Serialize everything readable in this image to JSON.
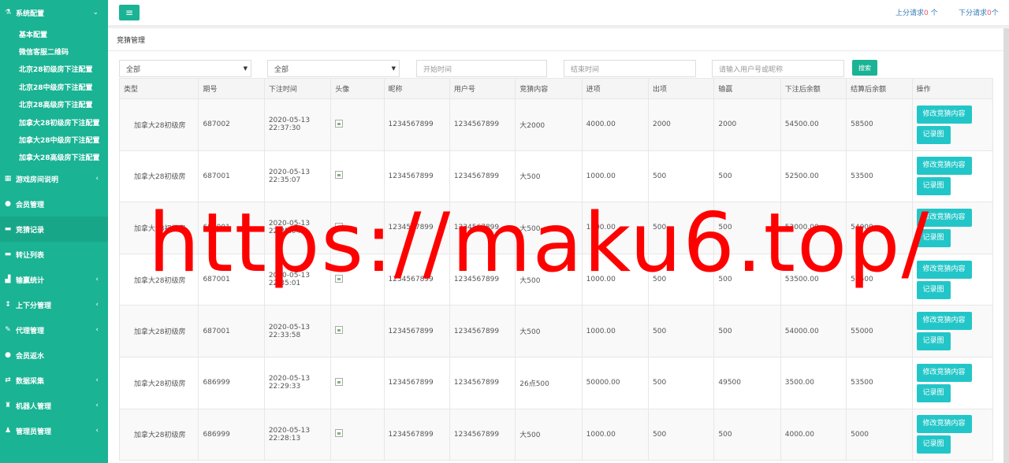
{
  "sidebar": {
    "sections": [
      {
        "label": "系统配置",
        "icon": "flask-icon",
        "expanded": true,
        "sub": [
          "基本配置",
          "微信客服二维码",
          "北京28初级房下注配置",
          "北京28中级房下注配置",
          "北京28高级房下注配置",
          "加拿大28初级房下注配置",
          "加拿大28中级房下注配置",
          "加拿大28高级房下注配置"
        ]
      },
      {
        "label": "游戏房间说明",
        "icon": "table-icon",
        "chevron": "‹"
      },
      {
        "label": "会员管理",
        "icon": "user-icon"
      },
      {
        "label": "竞猜记录",
        "icon": "car-icon",
        "active": true
      },
      {
        "label": "转让列表",
        "icon": "car-icon"
      },
      {
        "label": "输赢统计",
        "icon": "chart-icon",
        "chevron": "‹"
      },
      {
        "label": "上下分管理",
        "icon": "updown-icon",
        "chevron": "‹"
      },
      {
        "label": "代理管理",
        "icon": "pencil-icon",
        "chevron": "‹"
      },
      {
        "label": "会员返水",
        "icon": "users-icon"
      },
      {
        "label": "数据采集",
        "icon": "shuffle-icon",
        "chevron": "‹"
      },
      {
        "label": "机器人管理",
        "icon": "robot-icon",
        "chevron": "‹"
      },
      {
        "label": "管理员管理",
        "icon": "admin-icon",
        "chevron": "‹"
      }
    ]
  },
  "topbar": {
    "menu_icon": "≡",
    "up_label": "上分请求",
    "up_count": "0",
    "up_unit": " 个",
    "down_label": "下分请求",
    "down_count": "0",
    "down_unit": "个"
  },
  "page": {
    "title": "竞猜管理"
  },
  "filters": {
    "select1": "全部",
    "select2": "全部",
    "start_placeholder": "开始时间",
    "end_placeholder": "结束时间",
    "user_placeholder": "请输入用户号或昵称",
    "search_label": "搜索"
  },
  "table": {
    "headers": [
      "类型",
      "期号",
      "下注时间",
      "头像",
      "昵称",
      "用户号",
      "竞猜内容",
      "进项",
      "出项",
      "输赢",
      "下注后余额",
      "结算后余额",
      "操作"
    ],
    "edit_label": "修改竞猜内容",
    "record_label": "记录图",
    "rows": [
      {
        "type": "加拿大28初级房",
        "period": "687002",
        "date": "2020-05-13",
        "time": "22:37:30",
        "nick": "1234567899",
        "uid": "1234567899",
        "content": "大2000",
        "in": "4000.00",
        "out": "2000",
        "win": "2000",
        "before": "54500.00",
        "after": "58500"
      },
      {
        "type": "加拿大28初级房",
        "period": "687001",
        "date": "2020-05-13",
        "time": "22:35:07",
        "nick": "1234567899",
        "uid": "1234567899",
        "content": "大500",
        "in": "1000.00",
        "out": "500",
        "win": "500",
        "before": "52500.00",
        "after": "53500"
      },
      {
        "type": "加拿大28初级房",
        "period": "687001",
        "date": "2020-05-13",
        "time": "22:35:04",
        "nick": "1234567899",
        "uid": "1234567899",
        "content": "大500",
        "in": "1000.00",
        "out": "500",
        "win": "500",
        "before": "53000.00",
        "after": "54000"
      },
      {
        "type": "加拿大28初级房",
        "period": "687001",
        "date": "2020-05-13",
        "time": "22:35:01",
        "nick": "1234567899",
        "uid": "1234567899",
        "content": "大500",
        "in": "1000.00",
        "out": "500",
        "win": "500",
        "before": "53500.00",
        "after": "54500"
      },
      {
        "type": "加拿大28初级房",
        "period": "687001",
        "date": "2020-05-13",
        "time": "22:33:58",
        "nick": "1234567899",
        "uid": "1234567899",
        "content": "大500",
        "in": "1000.00",
        "out": "500",
        "win": "500",
        "before": "54000.00",
        "after": "55000"
      },
      {
        "type": "加拿大28初级房",
        "period": "686999",
        "date": "2020-05-13",
        "time": "22:29:33",
        "nick": "1234567899",
        "uid": "1234567899",
        "content": "26点500",
        "in": "50000.00",
        "out": "500",
        "win": "49500",
        "before": "3500.00",
        "after": "53500"
      },
      {
        "type": "加拿大28初级房",
        "period": "686999",
        "date": "2020-05-13",
        "time": "22:28:13",
        "nick": "1234567899",
        "uid": "1234567899",
        "content": "大500",
        "in": "1000.00",
        "out": "500",
        "win": "500",
        "before": "4000.00",
        "after": "5000"
      }
    ]
  },
  "watermark": "https://maku6.top/",
  "colors": {
    "sidebar": "#1ab394",
    "accent": "#23c6c8",
    "alert": "#ed5565",
    "watermark": "#ff0000"
  }
}
